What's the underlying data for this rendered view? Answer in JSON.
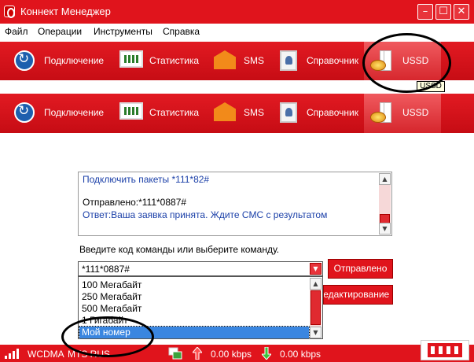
{
  "window": {
    "title": "Коннект Менеджер",
    "minimize_glyph": "–",
    "maximize_glyph": "☐",
    "close_glyph": "✕"
  },
  "menu": [
    "Файл",
    "Операции",
    "Инструменты",
    "Справка"
  ],
  "toolbar": {
    "items": [
      {
        "label": "Подключение",
        "icon": "refresh-icon"
      },
      {
        "label": "Статистика",
        "icon": "monitor-chart-icon"
      },
      {
        "label": "SMS",
        "icon": "envelope-icon"
      },
      {
        "label": "Справочник",
        "icon": "contacts-book-icon"
      },
      {
        "label": "USSD",
        "icon": "ussd-coin-icon"
      }
    ],
    "active": "USSD"
  },
  "tooltip": "USSD",
  "log": {
    "lines": [
      {
        "text": "Подключить пакеты *111*82#",
        "color": "#1a3fa8"
      },
      {
        "text": "Отправлено:*111*0887#",
        "color": "#000000"
      },
      {
        "text": "Ответ:Ваша заявка принята. Ждите СМС с результатом",
        "color": "#1a3fa8"
      }
    ]
  },
  "prompt": "Введите код команды или выберите команду.",
  "command_input": {
    "value": "*111*0887#"
  },
  "dropdown": {
    "options": [
      "100 Мегабайт",
      "250 Мегабайт",
      "500 Мегабайт",
      "1 Гигабайт",
      "Мой номер"
    ],
    "selected": "Мой номер"
  },
  "buttons": {
    "send": "Отправлено",
    "edit": "Редактирование"
  },
  "status": {
    "network": "WCDMA",
    "operator": "MTS RUS",
    "upload": "0.00 kbps",
    "download": "0.00 kbps"
  },
  "colors": {
    "brand_red": "#e0141c",
    "selection_blue": "#3a86e0",
    "text_blue": "#1a3fa8"
  }
}
